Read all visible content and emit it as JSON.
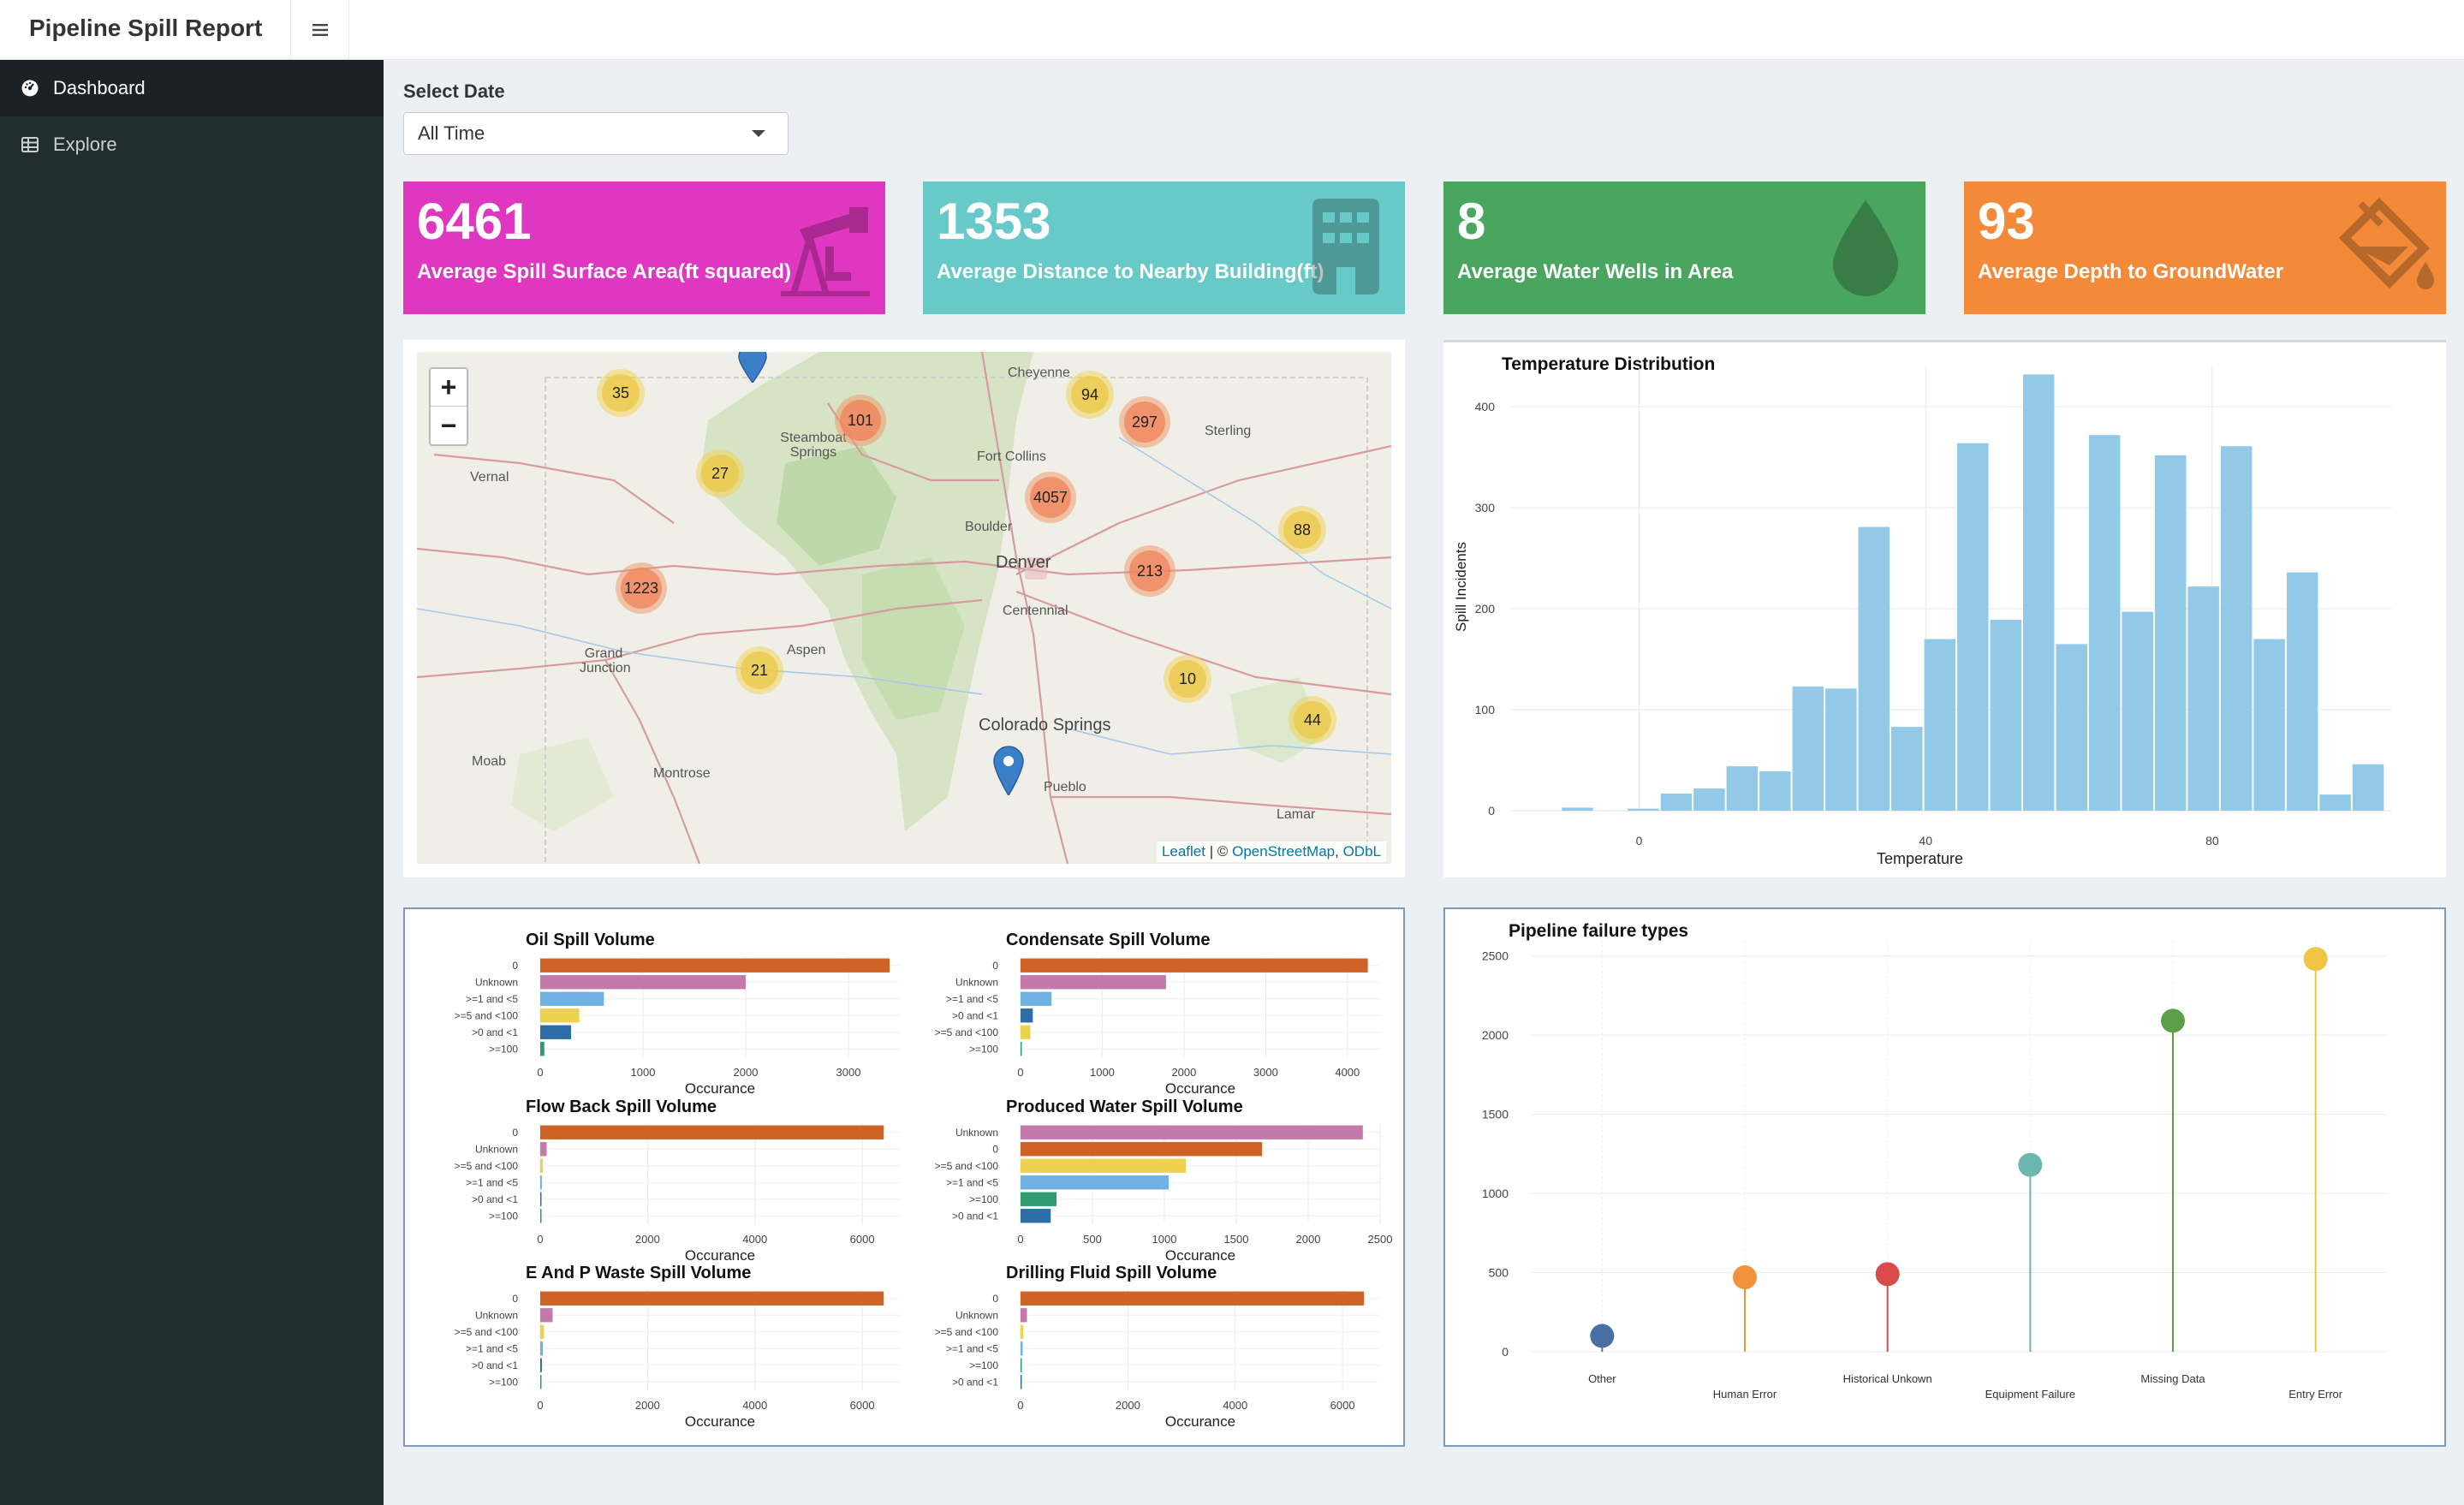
{
  "app": {
    "title": "Pipeline Spill Report",
    "menu_icon": "bars-icon"
  },
  "sidebar": {
    "items": [
      {
        "label": "Dashboard",
        "icon": "dashboard-icon",
        "active": true
      },
      {
        "label": "Explore",
        "icon": "table-icon",
        "active": false
      }
    ]
  },
  "filter": {
    "label": "Select Date",
    "value": "All Time"
  },
  "value_boxes": [
    {
      "value": "6461",
      "label": "Average Spill Surface Area(ft squared)",
      "color": "#e037c0",
      "icon": "oil-pump-icon"
    },
    {
      "value": "1353",
      "label": "Average Distance to Nearby Building(ft)",
      "color": "#68c9c9",
      "icon": "building-icon"
    },
    {
      "value": "8",
      "label": "Average Water Wells in Area",
      "color": "#4aa65f",
      "icon": "water-drop-icon"
    },
    {
      "value": "93",
      "label": "Average Depth to GroundWater",
      "color": "#f28a3a",
      "icon": "paint-bucket-icon"
    }
  ],
  "map": {
    "zoom_in": "+",
    "zoom_out": "−",
    "attribution": {
      "leaflet": "Leaflet",
      "sep": " | © ",
      "osm": "OpenStreetMap",
      "comma": ", ",
      "odbl": "ODbL"
    },
    "clusters": [
      "35",
      "101",
      "94",
      "297",
      "27",
      "4057",
      "88",
      "1223",
      "213",
      "21",
      "10",
      "44"
    ],
    "cities": [
      "Cheyenne",
      "Steamboat Springs",
      "Fort Collins",
      "Sterling",
      "Vernal",
      "Boulder",
      "Denver",
      "Centennial",
      "Grand Junction",
      "Aspen",
      "Colorado Springs",
      "Moab",
      "Montrose",
      "Pueblo",
      "Lamar"
    ]
  },
  "chart_data": [
    {
      "type": "bar",
      "title": "Temperature Distribution",
      "xlabel": "Temperature",
      "ylabel": "Spill Incidents",
      "x_ticks": [
        0,
        40,
        80
      ],
      "y_ticks": [
        0,
        100,
        200,
        300,
        400
      ],
      "xlim": [
        -18,
        105
      ],
      "ylim": [
        0,
        440
      ],
      "bin_width": 4.6,
      "bins": [
        {
          "x": -8.5,
          "value": 3
        },
        {
          "x": 0.7,
          "value": 2
        },
        {
          "x": 5.3,
          "value": 17
        },
        {
          "x": 9.9,
          "value": 22
        },
        {
          "x": 14.5,
          "value": 44
        },
        {
          "x": 19.1,
          "value": 39
        },
        {
          "x": 23.7,
          "value": 123
        },
        {
          "x": 28.3,
          "value": 121
        },
        {
          "x": 32.9,
          "value": 281
        },
        {
          "x": 37.5,
          "value": 83
        },
        {
          "x": 42.1,
          "value": 170
        },
        {
          "x": 46.7,
          "value": 364
        },
        {
          "x": 51.3,
          "value": 189
        },
        {
          "x": 55.9,
          "value": 432
        },
        {
          "x": 60.5,
          "value": 165
        },
        {
          "x": 65.1,
          "value": 372
        },
        {
          "x": 69.7,
          "value": 197
        },
        {
          "x": 74.3,
          "value": 352
        },
        {
          "x": 78.9,
          "value": 222
        },
        {
          "x": 83.5,
          "value": 361
        },
        {
          "x": 88.1,
          "value": 170
        },
        {
          "x": 92.7,
          "value": 236
        },
        {
          "x": 97.3,
          "value": 16
        },
        {
          "x": 101.9,
          "value": 46
        }
      ],
      "color": "#92c8e8"
    },
    {
      "type": "lollipop",
      "title": "Pipeline failure types",
      "categories": [
        "Other",
        "Human Error",
        "Historical Unkown",
        "Equipment Failure",
        "Missing Data",
        "Entry Error"
      ],
      "values": [
        100,
        470,
        490,
        1180,
        2090,
        2480
      ],
      "colors": [
        "#4a6fa5",
        "#f0933c",
        "#d94b4b",
        "#6db5b0",
        "#5d9f47",
        "#efc543"
      ],
      "y_ticks": [
        0,
        500,
        1000,
        1500,
        2000,
        2500
      ],
      "ylim": [
        0,
        2600
      ]
    },
    {
      "type": "bar",
      "orientation": "horizontal",
      "title": "Oil Spill Volume",
      "xlabel": "Occurance",
      "categories": [
        "0",
        "Unknown",
        ">=1 and <5",
        ">=5 and <100",
        ">0 and <1",
        ">=100"
      ],
      "values": [
        3400,
        2000,
        620,
        380,
        300,
        40
      ],
      "x_ticks": [
        0,
        1000,
        2000,
        3000
      ],
      "xlim": [
        0,
        3500
      ]
    },
    {
      "type": "bar",
      "orientation": "horizontal",
      "title": "Condensate Spill Volume",
      "xlabel": "Occurance",
      "categories": [
        "0",
        "Unknown",
        ">=1 and <5",
        ">0 and <1",
        ">=5 and <100",
        ">=100"
      ],
      "values": [
        4250,
        1780,
        380,
        150,
        120,
        10
      ],
      "x_ticks": [
        0,
        1000,
        2000,
        3000,
        4000
      ],
      "xlim": [
        0,
        4400
      ]
    },
    {
      "type": "bar",
      "orientation": "horizontal",
      "title": "Flow Back Spill Volume",
      "xlabel": "Occurance",
      "categories": [
        "0",
        "Unknown",
        ">=5 and <100",
        ">=1 and <5",
        ">0 and <1",
        ">=100"
      ],
      "values": [
        6400,
        120,
        50,
        30,
        20,
        10
      ],
      "x_ticks": [
        0,
        2000,
        4000,
        6000
      ],
      "xlim": [
        0,
        6700
      ]
    },
    {
      "type": "bar",
      "orientation": "horizontal",
      "title": "Produced Water Spill Volume",
      "xlabel": "Occurance",
      "categories": [
        "Unknown",
        "0",
        ">=5 and <100",
        ">=1 and <5",
        ">=100",
        ">0 and <1"
      ],
      "values": [
        2380,
        1680,
        1150,
        1030,
        250,
        210
      ],
      "x_ticks": [
        0,
        500,
        1000,
        1500,
        2000,
        2500
      ],
      "xlim": [
        0,
        2500
      ]
    },
    {
      "type": "bar",
      "orientation": "horizontal",
      "title": "E And P Waste Spill Volume",
      "xlabel": "Occurance",
      "categories": [
        "0",
        "Unknown",
        ">=5 and <100",
        ">=1 and <5",
        ">0 and <1",
        ">=100"
      ],
      "values": [
        6400,
        230,
        70,
        50,
        30,
        10
      ],
      "x_ticks": [
        0,
        2000,
        4000,
        6000
      ],
      "xlim": [
        0,
        6700
      ]
    },
    {
      "type": "bar",
      "orientation": "horizontal",
      "title": "Drilling Fluid Spill Volume",
      "xlabel": "Occurance",
      "categories": [
        "0",
        "Unknown",
        ">=5 and <100",
        ">=1 and <5",
        ">=100",
        ">0 and <1"
      ],
      "values": [
        6400,
        120,
        50,
        40,
        20,
        10
      ],
      "x_ticks": [
        0,
        2000,
        4000,
        6000
      ],
      "xlim": [
        0,
        6700
      ]
    }
  ]
}
